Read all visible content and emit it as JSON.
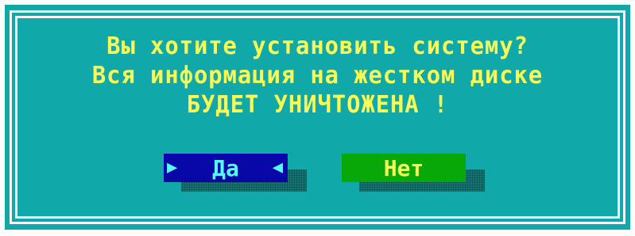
{
  "dialog": {
    "message_lines": [
      "Вы хотите установить систему?",
      "Вся информация на жестком диске",
      "БУДЕТ УНИЧТОЖЕНА !"
    ],
    "colors": {
      "background": "#10a8a8",
      "text": "#fbfb55",
      "frame": "#f4f4f4"
    }
  },
  "buttons": {
    "yes": {
      "label": "Да",
      "selected": true,
      "left_marker_icon": "triangle-right-icon",
      "right_marker_icon": "triangle-left-icon",
      "colors": {
        "background": "#0808a8",
        "text": "#58f8f8"
      }
    },
    "no": {
      "label": "Нет",
      "selected": false,
      "colors": {
        "background": "#08a808",
        "text": "#fbfb55"
      }
    }
  }
}
